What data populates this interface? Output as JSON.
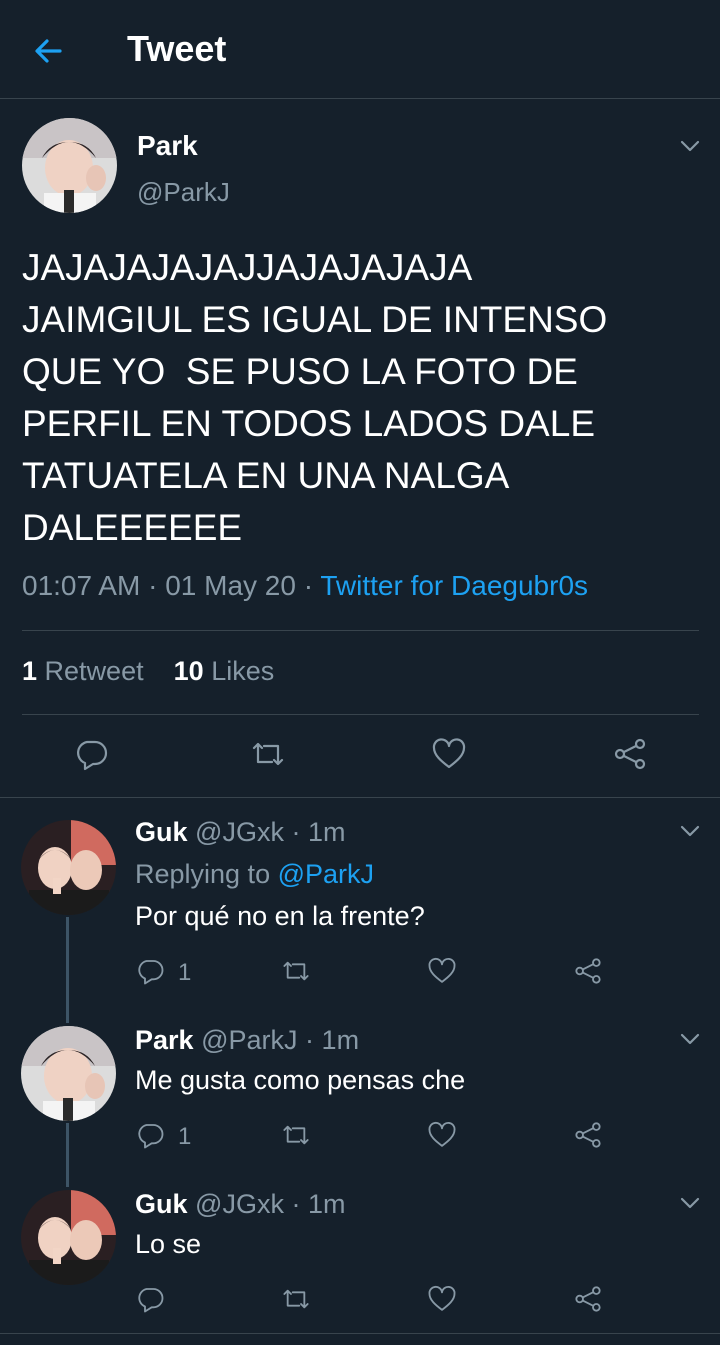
{
  "header": {
    "title": "Tweet",
    "back_icon": "arrow-left-icon",
    "accent": "#1da1f2"
  },
  "main_tweet": {
    "name": "Park",
    "handle": "@ParkJ",
    "text": "JAJAJAJAJAJJAJAJAJAJA\nJAIMGIUL ES IGUAL DE INTENSO\nQUE YO  SE PUSO LA FOTO DE\nPERFIL EN TODOS LADOS DALE\nTATUATELA EN UNA NALGA\nDALEEEEEE",
    "time": "01:07 AM",
    "date": "01 May 20",
    "source": "Twitter for Daegubr0s",
    "retweets_count": "1",
    "retweets_label": "Retweet",
    "likes_count": "10",
    "likes_label": "Likes"
  },
  "replies": [
    {
      "name": "Guk",
      "handle": "@JGxk",
      "time": "1m",
      "replying_prefix": "Replying to",
      "replying_to": "@ParkJ",
      "text": "Por qué no en la frente?",
      "reply_count": "1"
    },
    {
      "name": "Park",
      "handle": "@ParkJ",
      "time": "1m",
      "text": "Me gusta como pensas che",
      "reply_count": "1"
    },
    {
      "name": "Guk",
      "handle": "@JGxk",
      "time": "1m",
      "text": "Lo se"
    }
  ],
  "separator": "·",
  "colors": {
    "background": "#15202b",
    "muted": "#8899a6",
    "link": "#1da1f2",
    "divider": "#38444d"
  }
}
